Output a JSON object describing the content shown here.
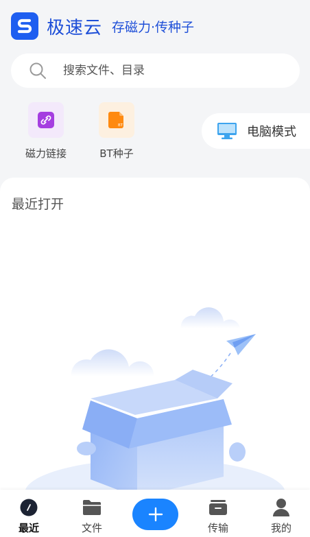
{
  "header": {
    "app_name": "极速云",
    "slogan": "存磁力·传种子"
  },
  "search": {
    "placeholder": "搜索文件、目录"
  },
  "tools": [
    {
      "label": "磁力链接",
      "icon": "magnet-link-icon"
    },
    {
      "label": "BT种子",
      "icon": "bt-torrent-icon"
    }
  ],
  "pc_mode": {
    "label": "电脑模式",
    "icon": "monitor-icon"
  },
  "recent": {
    "title": "最近打开",
    "illustration": "empty-box-icon"
  },
  "tabbar": {
    "items": [
      {
        "label": "最近",
        "icon": "clock-icon",
        "active": true
      },
      {
        "label": "文件",
        "icon": "folder-icon"
      },
      {
        "label": "",
        "icon": "plus-icon"
      },
      {
        "label": "传输",
        "icon": "transfer-icon"
      },
      {
        "label": "我的",
        "icon": "person-icon"
      }
    ]
  },
  "colors": {
    "brand": "#1e5ef0",
    "accent": "#1a84ff",
    "magnet_tile": "#f3e9fb",
    "bt_tile": "#fdf0e0"
  }
}
